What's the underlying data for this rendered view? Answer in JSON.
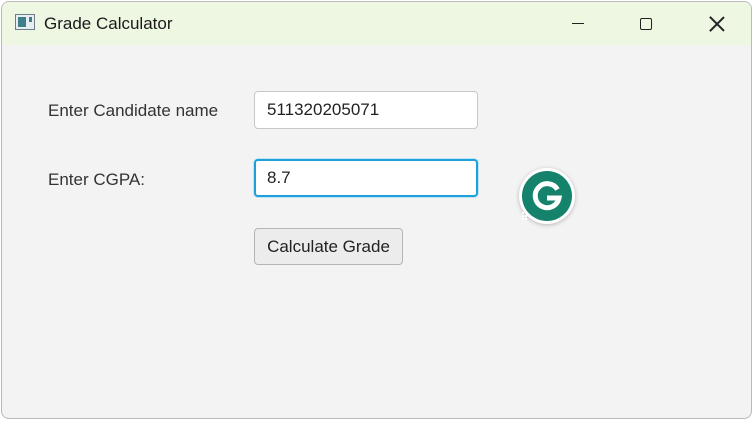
{
  "window": {
    "title": "Grade Calculator",
    "controls": [
      "minimize",
      "maximize",
      "close"
    ]
  },
  "form": {
    "name_label": "Enter Candidate name",
    "name_value": "511320205071",
    "cgpa_label": "Enter CGPA:",
    "cgpa_value": "8.7",
    "calculate_button": "Calculate Grade"
  },
  "overlay": {
    "icon": "grammarly-icon",
    "letter": "G"
  },
  "colors": {
    "titlebar": "#eef7e2",
    "window_bg": "#f3f3f3",
    "focus_border": "#1ea0d8",
    "grammarly_green": "#15826c"
  }
}
